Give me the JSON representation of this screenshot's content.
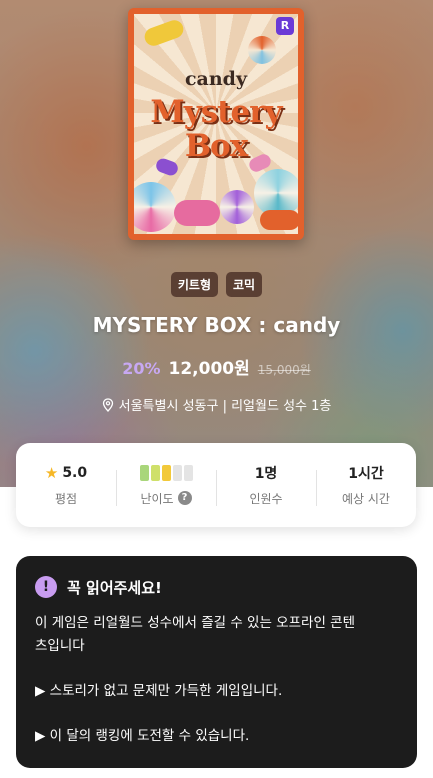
{
  "hero": {
    "poster": {
      "logo_text": "R",
      "word_small": "candy",
      "word_mystery": "Mystery",
      "word_box": "Box"
    },
    "tags": [
      "키트형",
      "코믹"
    ],
    "title": "MYSTERY BOX : candy",
    "discount": "20%",
    "price": "12,000원",
    "original_price": "15,000원",
    "location": "서울특별시 성동구 | 리얼월드 성수 1층",
    "location_icon": "map-pin-icon"
  },
  "stats": {
    "rating": {
      "value": "5.0",
      "label": "평점",
      "icon": "star-icon"
    },
    "difficulty": {
      "label": "난이도",
      "level": 3,
      "max": 5,
      "colors": [
        "#a9d67b",
        "#cfe06a",
        "#f2c93a"
      ],
      "help_icon": "question-icon"
    },
    "players": {
      "value": "1명",
      "label": "인원수"
    },
    "duration": {
      "value": "1시간",
      "label": "예상 시간"
    }
  },
  "notice": {
    "icon": "alert-icon",
    "title": "꼭 읽어주세요!",
    "line1": "이 게임은 리얼월드 성수에서 즐길 수 있는 오프라인 콘텐",
    "line2": "츠입니다",
    "line3": "▶ 스토리가 없고 문제만 가득한 게임입니다.",
    "line4": "▶ 이 달의 랭킹에 도전할 수 있습니다."
  },
  "colors": {
    "accent_purple": "#c89cf0",
    "poster_orange": "#e2612c",
    "chip_brown": "#5a3f33",
    "notice_bg": "#1c1c1c"
  }
}
